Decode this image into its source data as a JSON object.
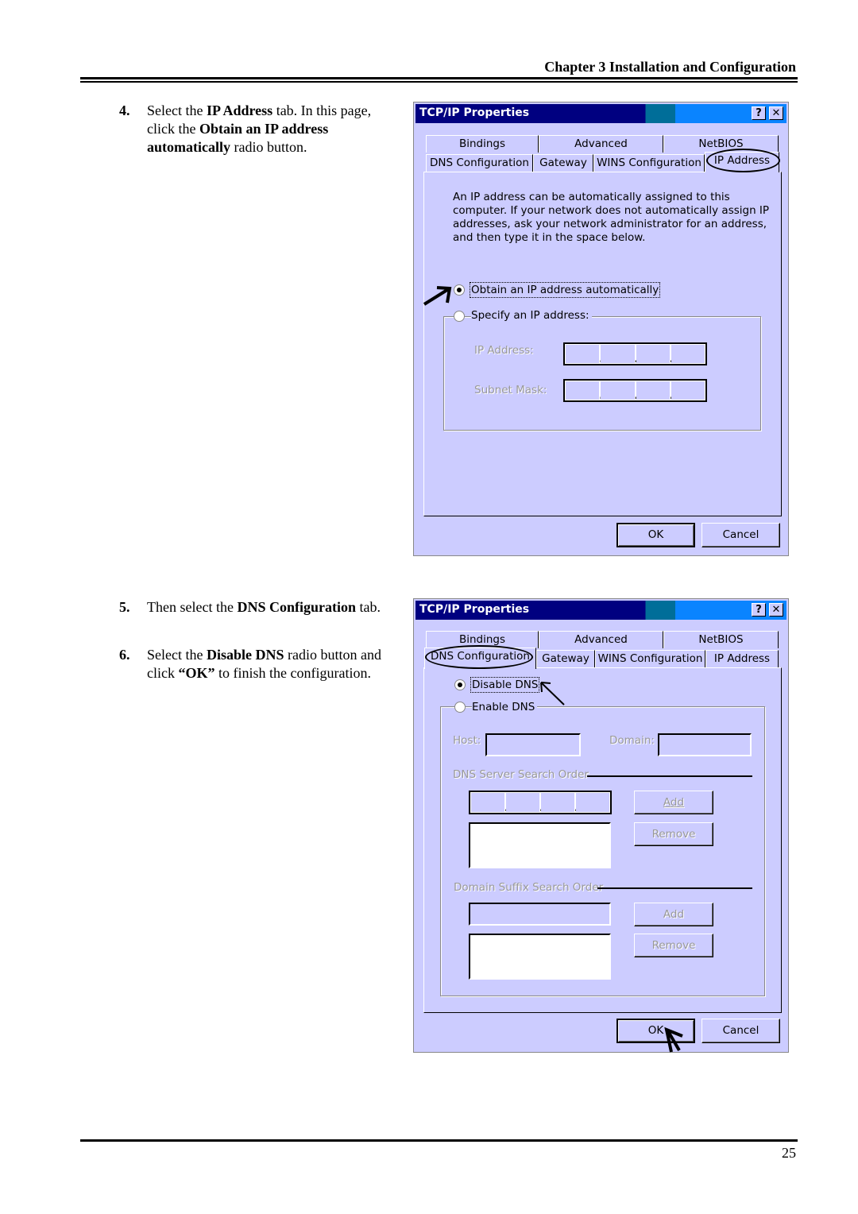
{
  "header": {
    "chapter_title": "Chapter 3 Installation and Configuration"
  },
  "footer": {
    "page_number": "25"
  },
  "steps": [
    {
      "num": "4.",
      "parts": [
        "Select the ",
        "IP Address",
        " tab. In this page, click the ",
        "Obtain an IP address automatically",
        " radio button."
      ]
    },
    {
      "num": "5.",
      "parts": [
        "Then select the ",
        "DNS Configuration",
        " tab."
      ]
    },
    {
      "num": "6.",
      "parts": [
        "Select the ",
        "Disable DNS",
        " radio button and click ",
        "“OK”",
        " to finish the configuration."
      ]
    }
  ],
  "dialog1": {
    "title": "TCP/IP Properties",
    "help_btn": "?",
    "close_btn": "✕",
    "tabs_row1": [
      "Bindings",
      "Advanced",
      "NetBIOS"
    ],
    "tabs_row2": [
      "DNS Configuration",
      "Gateway",
      "WINS Configuration",
      "IP Address"
    ],
    "active_tab": "IP Address",
    "description": "An IP address can be automatically assigned to this computer. If your network does not automatically assign IP addresses, ask your network administrator for an address, and then type it in the space below.",
    "radio_obtain": "Obtain an IP address automatically",
    "radio_specify": "Specify an IP address:",
    "selected_radio": "obtain",
    "ip_label": "IP Address:",
    "mask_label": "Subnet Mask:",
    "ok": "OK",
    "cancel": "Cancel"
  },
  "dialog2": {
    "title": "TCP/IP Properties",
    "help_btn": "?",
    "close_btn": "✕",
    "tabs_row1": [
      "Bindings",
      "Advanced",
      "NetBIOS"
    ],
    "tabs_row2": [
      "DNS Configuration",
      "Gateway",
      "WINS Configuration",
      "IP Address"
    ],
    "active_tab": "DNS Configuration",
    "radio_disable": "Disable DNS",
    "radio_enable": "Enable DNS",
    "selected_radio": "disable",
    "host_label": "Host:",
    "domain_label": "Domain:",
    "dns_order_label": "DNS Server Search Order",
    "suffix_order_label": "Domain Suffix Search Order",
    "add": "Add",
    "remove": "Remove",
    "ok": "OK",
    "cancel": "Cancel"
  }
}
